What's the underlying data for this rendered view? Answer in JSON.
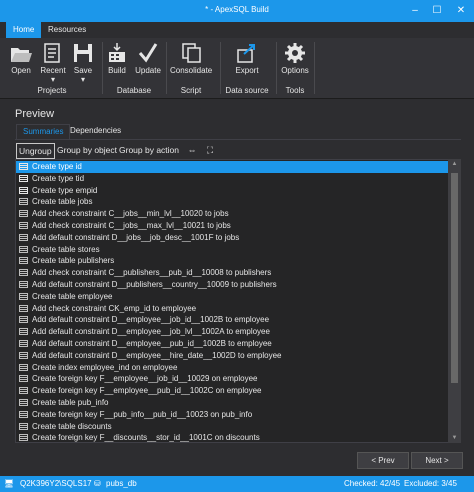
{
  "window": {
    "title": "* - ApexSQL Build",
    "minimize": "–",
    "maximize": "☐",
    "close": "✕"
  },
  "ribbon_tabs": [
    {
      "label": "Home"
    },
    {
      "label": "Resources"
    }
  ],
  "ribbon": {
    "open": "Open",
    "recent": "Recent",
    "save": "Save",
    "build": "Build",
    "update": "Update",
    "consolidate": "Consolidate",
    "export": "Export",
    "options": "Options",
    "groups": {
      "projects": "Projects",
      "database": "Database",
      "script": "Script",
      "data_source": "Data source",
      "tools": "Tools"
    }
  },
  "preview": {
    "title": "Preview",
    "tabs": [
      {
        "label": "Summaries"
      },
      {
        "label": "Dependencies"
      }
    ],
    "toolbar": {
      "ungroup": "Ungroup",
      "group_by_object": "Group by object",
      "group_by_action": "Group by action"
    },
    "rows": [
      {
        "label": "Create type id",
        "icon": "script",
        "selected": true
      },
      {
        "label": "Create type tid",
        "icon": "script"
      },
      {
        "label": "Create type empid",
        "icon": "script"
      },
      {
        "label": "Create table jobs",
        "icon": "table"
      },
      {
        "label": "Add check constraint C__jobs__min_lvl__10020 to jobs",
        "icon": "table"
      },
      {
        "label": "Add check constraint C__jobs__max_lvl__10021 to jobs",
        "icon": "table"
      },
      {
        "label": "Add default constraint D__jobs__job_desc__1001F to jobs",
        "icon": "table"
      },
      {
        "label": "Create table stores",
        "icon": "table"
      },
      {
        "label": "Create table publishers",
        "icon": "table"
      },
      {
        "label": "Add check constraint C__publishers__pub_id__10008 to publishers",
        "icon": "table"
      },
      {
        "label": "Add default constraint D__publishers__country__10009 to publishers",
        "icon": "table"
      },
      {
        "label": "Create table employee",
        "icon": "table"
      },
      {
        "label": "Add check constraint CK_emp_id to employee",
        "icon": "table"
      },
      {
        "label": "Add default constraint D__employee__job_id__1002B to employee",
        "icon": "table"
      },
      {
        "label": "Add default constraint D__employee__job_lvl__1002A to employee",
        "icon": "table"
      },
      {
        "label": "Add default constraint D__employee__pub_id__1002B to employee",
        "icon": "table"
      },
      {
        "label": "Add default constraint D__employee__hire_date__1002D to employee",
        "icon": "table"
      },
      {
        "label": "Create index employee_ind on employee",
        "icon": "table"
      },
      {
        "label": "Create foreign key F__employee__job_id__10029 on employee",
        "icon": "table"
      },
      {
        "label": "Create foreign key F__employee__pub_id__1002C on employee",
        "icon": "table"
      },
      {
        "label": "Create table pub_info",
        "icon": "table"
      },
      {
        "label": "Create foreign key F__pub_info__pub_id__10023 on pub_info",
        "icon": "table"
      },
      {
        "label": "Create table discounts",
        "icon": "table"
      },
      {
        "label": "Create foreign key F__discounts__stor_id__1001C on discounts",
        "icon": "table"
      }
    ]
  },
  "nav": {
    "prev": "< Prev",
    "next": "Next >"
  },
  "status": {
    "server": "Q2K396Y2\\SQLS17",
    "database": "pubs_db",
    "checked": "Checked: 42/45",
    "excluded": "Excluded: 3/45"
  },
  "colors": {
    "accent": "#1c97ea",
    "background": "#2d2d30",
    "list_background": "#252526"
  }
}
